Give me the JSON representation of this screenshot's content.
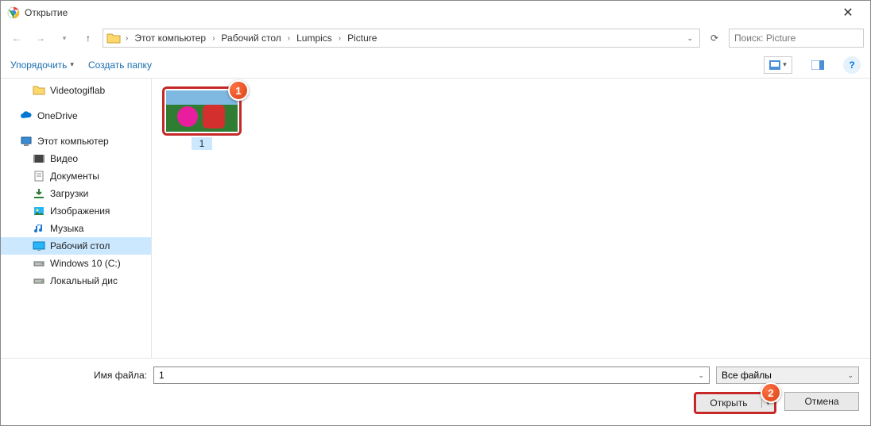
{
  "title": "Открытие",
  "breadcrumb": [
    "Этот компьютер",
    "Рабочий стол",
    "Lumpics",
    "Picture"
  ],
  "search_placeholder": "Поиск: Picture",
  "toolbar": {
    "organize": "Упорядочить",
    "new_folder": "Создать папку"
  },
  "sidebar": {
    "items": [
      {
        "label": "Videotogiflab",
        "icon": "folder",
        "level": 2
      },
      {
        "spacer": true
      },
      {
        "label": "OneDrive",
        "icon": "onedrive",
        "level": 1
      },
      {
        "spacer": true
      },
      {
        "label": "Этот компьютер",
        "icon": "pc",
        "level": 1
      },
      {
        "label": "Видео",
        "icon": "video",
        "level": 2
      },
      {
        "label": "Документы",
        "icon": "docs",
        "level": 2
      },
      {
        "label": "Загрузки",
        "icon": "downloads",
        "level": 2
      },
      {
        "label": "Изображения",
        "icon": "pictures",
        "level": 2
      },
      {
        "label": "Музыка",
        "icon": "music",
        "level": 2
      },
      {
        "label": "Рабочий стол",
        "icon": "desktop",
        "level": 2,
        "selected": true
      },
      {
        "label": "Windows 10 (C:)",
        "icon": "drive",
        "level": 2
      },
      {
        "label": "Локальный дис",
        "icon": "drive",
        "level": 2
      }
    ]
  },
  "file": {
    "name": "1"
  },
  "footer": {
    "filename_label": "Имя файла:",
    "filename_value": "1",
    "filetype_value": "Все файлы",
    "open": "Открыть",
    "cancel": "Отмена"
  },
  "markers": {
    "m1": "1",
    "m2": "2"
  }
}
